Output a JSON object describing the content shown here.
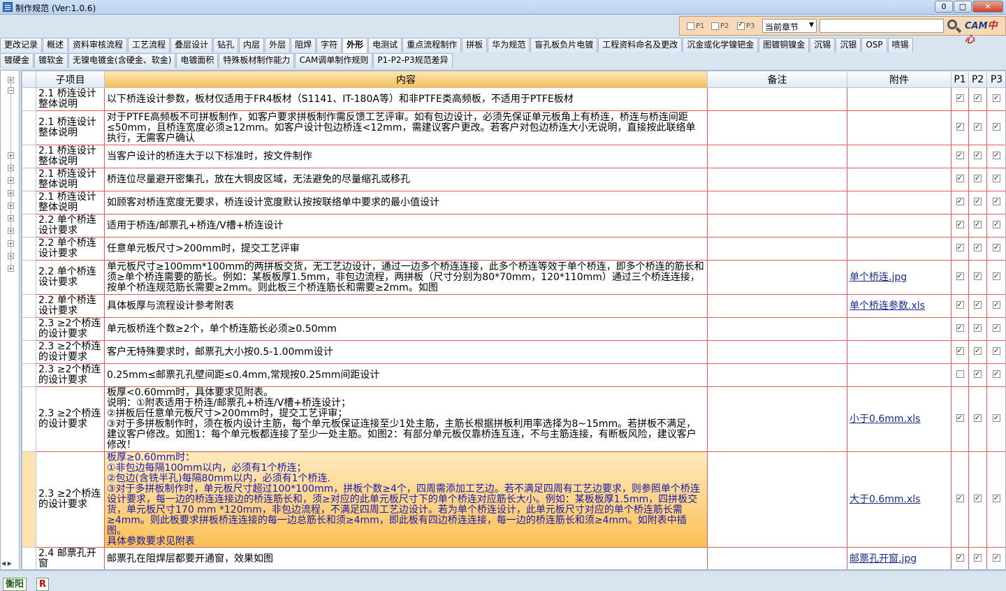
{
  "window": {
    "title": "制作规范 (Ver:1.0.6)",
    "minimize": "0",
    "maximize": "□",
    "close": "✕"
  },
  "filters": {
    "p1": "P1",
    "p2": "P2",
    "p3": "P3",
    "p1_checked": false,
    "p2_checked": false,
    "p3_checked": true,
    "scope": "当前章节",
    "search_value": "",
    "logo_text": "CAM",
    "logo_cn": "中心"
  },
  "tabs_row1": [
    "更改记录",
    "概述",
    "资料审核流程",
    "工艺流程",
    "叠层设计",
    "钻孔",
    "内层",
    "外层",
    "阻焊",
    "字符",
    "外形",
    "电测试",
    "重点流程制作",
    "拼板",
    "华为规范",
    "盲孔板负片电镀",
    "工程资料命名及更改",
    "沉金或化学镍钯金",
    "图镀铜镍金",
    "沉锡",
    "沉银",
    "OSP",
    "喷锡"
  ],
  "tabs_row2": [
    "镀硬金",
    "镀软金",
    "无镍电镀金(含硬金、软金)",
    "电镀面积",
    "特殊板材制作能力",
    "CAM调单制作规则",
    "P1-P2-P3规范差异"
  ],
  "active_tab": "外形",
  "columns": {
    "sub": "子项目",
    "content": "内容",
    "remark": "备注",
    "attach": "附件",
    "p1": "P1",
    "p2": "P2",
    "p3": "P3"
  },
  "rows": [
    {
      "sub": "2.1 桥连设计整体说明",
      "content": "以下桥连设计参数，板材仅适用于FR4板材（S1141、IT-180A等）和非PTFE类高频板，不适用于PTFE板材",
      "remark": "",
      "attach": "",
      "p1": true,
      "p2": true,
      "p3": true
    },
    {
      "sub": "2.1 桥连设计整体说明",
      "content": "对于PTFE高频板不可拼板制作，如客户要求拼板制作需反馈工艺评审。如有包边设计，必须先保证单元板角上有桥连，桥连与桥连间距≤50mm，且桥连宽度必须≥12mm。如客户设计包边桥连<12mm，需建议客户更改。若客户对包边桥连大小无说明，直接按此联络单执行，无需客户确认",
      "remark": "",
      "attach": "",
      "p1": true,
      "p2": true,
      "p3": true
    },
    {
      "sub": "2.1 桥连设计整体说明",
      "content": "当客户设计的桥连大于以下标准时，按文件制作",
      "remark": "",
      "attach": "",
      "p1": true,
      "p2": true,
      "p3": true
    },
    {
      "sub": "2.1 桥连设计整体说明",
      "content": "桥连位尽量避开密集孔，放在大铜皮区域，无法避免的尽量缩孔或移孔",
      "remark": "",
      "attach": "",
      "p1": true,
      "p2": true,
      "p3": true
    },
    {
      "sub": "2.1 桥连设计整体说明",
      "content": "如顾客对桥连宽度无要求，桥连设计宽度默认按按联络单中要求的最小值设计",
      "remark": "",
      "attach": "",
      "p1": true,
      "p2": true,
      "p3": true
    },
    {
      "sub": "2.2 单个桥连设计要求",
      "content": "适用于桥连/邮票孔+桥连/V槽+桥连设计",
      "remark": "",
      "attach": "",
      "p1": true,
      "p2": true,
      "p3": true
    },
    {
      "sub": "2.2 单个桥连设计要求",
      "content": "任意单元板尺寸>200mm时，提交工艺评审",
      "remark": "",
      "attach": "",
      "p1": true,
      "p2": true,
      "p3": true
    },
    {
      "sub": "2.2 单个桥连设计要求",
      "content": "单元板尺寸≥100mm*100mm的两拼板交货，无工艺边设计，通过一边多个桥连连接，此多个桥连等效于单个桥连，即多个桥连的筋长和须≥单个桥连需要的筋长。例如：某板板厚1.5mm，非包边流程，两拼板（尺寸分别为80*70mm，120*110mm）通过三个桥连连接，按单个桥连规范筋长需要≥2mm。则此板三个桥连筋长和需要≥2mm。如图",
      "remark": "",
      "attach": "单个桥连.jpg",
      "p1": true,
      "p2": true,
      "p3": true
    },
    {
      "sub": "2.2 单个桥连设计要求",
      "content": "具体板厚与流程设计参考附表",
      "remark": "",
      "attach": "单个桥连参数.xls",
      "p1": true,
      "p2": true,
      "p3": true
    },
    {
      "sub": "2.3 ≥2个桥连的设计要求",
      "content": "单元板桥连个数≥2个，单个桥连筋长必须≥0.50mm",
      "remark": "",
      "attach": "",
      "p1": true,
      "p2": true,
      "p3": true
    },
    {
      "sub": "2.3 ≥2个桥连的设计要求",
      "content": "客户无特殊要求时，邮票孔大小按0.5-1.00mm设计",
      "remark": "",
      "attach": "",
      "p1": true,
      "p2": true,
      "p3": true
    },
    {
      "sub": "2.3 ≥2个桥连的设计要求",
      "content": "0.25mm≤邮票孔孔壁间距≤0.4mm,常规按0.25mm间距设计",
      "remark": "",
      "attach": "",
      "p1": false,
      "p2": true,
      "p3": true
    },
    {
      "sub": "2.3 ≥2个桥连的设计要求",
      "content": "板厚<0.60mm时，具体要求见附表。\n说明：①附表适用于桥连/邮票孔+桥连/V槽+桥连设计；\n②拼板后任意单元板尺寸>200mm时，提交工艺评审；\n③对于多拼板制作时，须在板内设计主筋，每个单元板保证连接至少1处主筋，主筋长根据拼板利用率选择为8~15mm。若拼板不满足，建议客户修改。如图1：每个单元板都连接了至少一处主筋。如图2：有部分单元板仅靠桥连互连，不与主筋连接，有断板风险，建议客户修改！",
      "remark": "",
      "attach": "小于0.6mm.xls",
      "p1": true,
      "p2": true,
      "p3": true
    },
    {
      "sub": "2.3 ≥2个桥连的设计要求",
      "content": "板厚≥0.60mm时：\n①非包边每隔100mm以内，必须有1个桥连；\n②包边(含铣半孔)每隔80mm以内，必须有1个桥连.\n③对于多拼板制作时，单元板尺寸超过100*100mm，拼板个数≥4个，四周需添加工艺边。若不满足四周有工艺边要求，则参照单个桥连设计要求，每一边的桥连连接边的桥连筋长和，须≥对应的此单元板尺寸下的单个桥连对应筋长大小。例如：某板板厚1.5mm，四拼板交货，单元板尺寸170 mm *120mm，非包边流程，不满足四周工艺边设计。若为单个桥连设计，此单元板尺寸对应的单个桥连筋长需≥4mm。则此板要求拼板桥连连接的每一边总筋长和须≥4mm，即此板有四边桥连连接，每一边的桥连筋长和须≥4mm。如附表中插图。\n具体参数要求见附表",
      "remark": "",
      "attach": "大于0.6mm.xls",
      "p1": true,
      "p2": true,
      "p3": true
    },
    {
      "sub": "2.4 邮票孔开窗",
      "content": "邮票孔在阻焊层都要开通窗，效果如图",
      "remark": "",
      "attach": "邮票孔开窗.jpg",
      "p1": true,
      "p2": true,
      "p3": true
    }
  ],
  "status": {
    "btn1": "衡阳",
    "btn2": "R"
  }
}
